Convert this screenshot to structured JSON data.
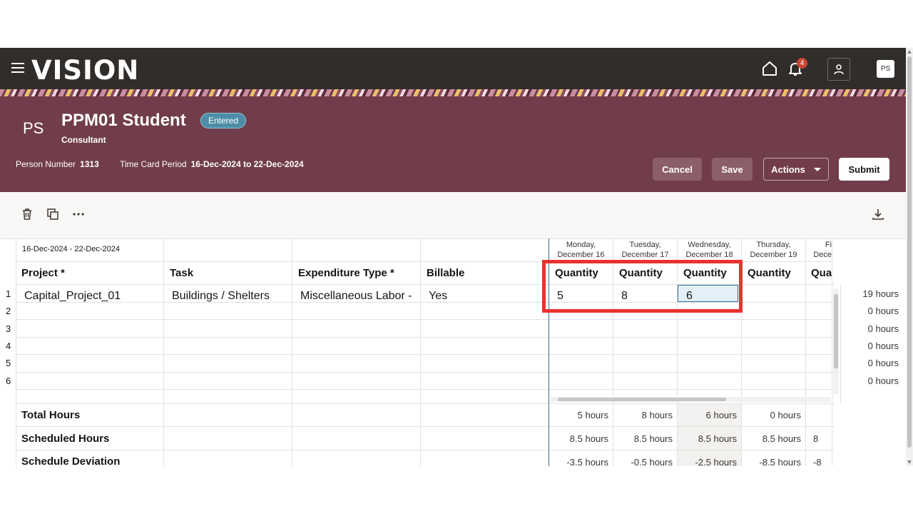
{
  "topbar": {
    "logo": "VISION",
    "notification_count": "4",
    "user_initials": "PS"
  },
  "header": {
    "avatar_initials": "PS",
    "name": "PPM01 Student",
    "status": "Entered",
    "title": "Consultant",
    "person_number_label": "Person Number",
    "person_number": "1313",
    "period_label": "Time Card Period",
    "period": "16-Dec-2024 to 22-Dec-2024",
    "buttons": {
      "cancel": "Cancel",
      "save": "Save",
      "actions": "Actions",
      "submit": "Submit"
    }
  },
  "grid": {
    "range": "16-Dec-2024 - 22-Dec-2024",
    "columns": {
      "project": "Project *",
      "task": "Task",
      "expenditure": "Expenditure Type *",
      "billable": "Billable"
    },
    "days": [
      {
        "day": "Monday,",
        "date": "December 16",
        "label": "Quantity"
      },
      {
        "day": "Tuesday,",
        "date": "December 17",
        "label": "Quantity"
      },
      {
        "day": "Wednesday,",
        "date": "December 18",
        "label": "Quantity"
      },
      {
        "day": "Thursday,",
        "date": "December 19",
        "label": "Quantity"
      },
      {
        "day": "Fi",
        "date": "Dece",
        "label": "Qua"
      }
    ],
    "rows": [
      {
        "num": "1",
        "project": "Capital_Project_01",
        "task": "Buildings / Shelters",
        "expenditure": "Miscellaneous Labor -",
        "billable": "Yes",
        "q": [
          "5",
          "8",
          "6",
          "",
          ""
        ],
        "total": "19 hours"
      },
      {
        "num": "2",
        "total": "0 hours"
      },
      {
        "num": "3",
        "total": "0 hours"
      },
      {
        "num": "4",
        "total": "0 hours"
      },
      {
        "num": "5",
        "total": "0 hours"
      },
      {
        "num": "6",
        "total": "0 hours"
      }
    ],
    "summary": [
      {
        "label": "Total Hours",
        "values": [
          "5 hours",
          "8 hours",
          "6 hours",
          "0 hours",
          ""
        ]
      },
      {
        "label": "Scheduled Hours",
        "values": [
          "8.5 hours",
          "8.5 hours",
          "8.5 hours",
          "8.5 hours",
          "8"
        ]
      },
      {
        "label": "Schedule Deviation",
        "values": [
          "-3.5 hours",
          "-0.5 hours",
          "-2.5 hours",
          "-8.5 hours",
          "-8"
        ]
      }
    ]
  }
}
